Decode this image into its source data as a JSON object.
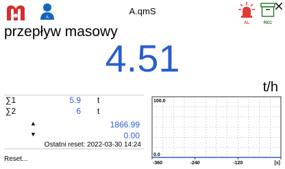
{
  "header": {
    "title": "A.qmS",
    "alarm_label": "AL",
    "rec_label": "REC",
    "colors": {
      "brand": "#d32f2f",
      "user": "#1565c0",
      "alarm": "#e53935",
      "rec": "#2e7d32"
    }
  },
  "measurement": {
    "name": "przepływ masowy",
    "value": "4.51",
    "unit": "t/h",
    "value_color": "#2a5ecf"
  },
  "totals": {
    "sum1": {
      "symbol": "∑1",
      "value": "5.9",
      "unit": "t"
    },
    "sum2": {
      "symbol": "∑2",
      "value": "6",
      "unit": "t"
    },
    "max": {
      "value": "1866.99"
    },
    "min": {
      "value": "0.00"
    },
    "last_reset": "Ostatni reset: 2022-03-30 14:24"
  },
  "buttons": {
    "reset_label": "Reset..."
  },
  "chart_data": {
    "type": "line",
    "ylim": [
      0.0,
      100.0
    ],
    "y_ticks": [
      "100.0",
      "0.0"
    ],
    "xlim": [
      -360,
      0
    ],
    "x_ticks": [
      "-360",
      "-240",
      "-120",
      "[s]"
    ],
    "series": [
      {
        "x": [
          -360,
          -300,
          -240,
          -180,
          -120,
          -60,
          0
        ],
        "y": [
          0,
          0,
          0,
          0,
          0,
          0,
          0
        ]
      }
    ],
    "grid": true
  }
}
